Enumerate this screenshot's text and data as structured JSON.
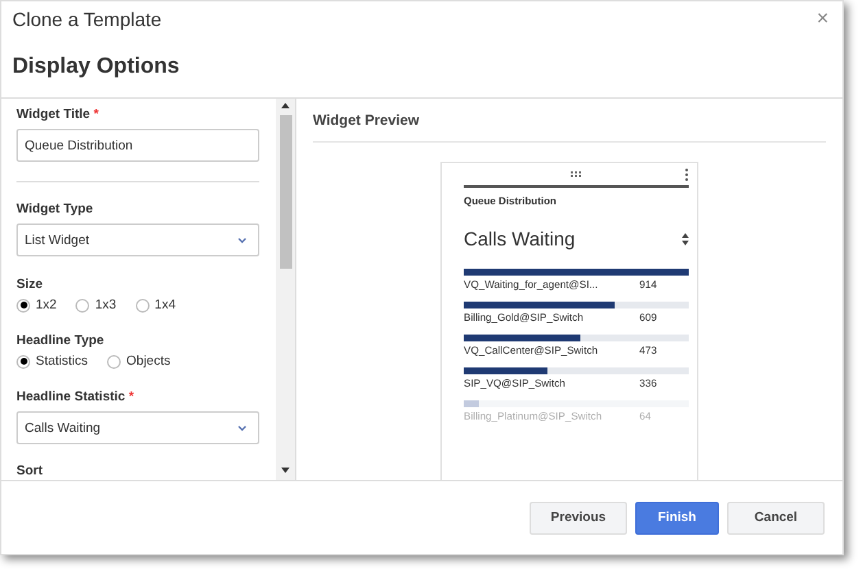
{
  "dialog": {
    "title": "Clone a Template",
    "close_icon": "×",
    "heading": "Display Options"
  },
  "form": {
    "widget_title": {
      "label": "Widget Title",
      "required_mark": "*",
      "value": "Queue Distribution"
    },
    "widget_type": {
      "label": "Widget Type",
      "value": "List Widget"
    },
    "size": {
      "label": "Size",
      "options": [
        {
          "label": "1x2",
          "selected": true
        },
        {
          "label": "1x3",
          "selected": false
        },
        {
          "label": "1x4",
          "selected": false
        }
      ]
    },
    "headline_type": {
      "label": "Headline Type",
      "options": [
        {
          "label": "Statistics",
          "selected": true
        },
        {
          "label": "Objects",
          "selected": false
        }
      ]
    },
    "headline_statistic": {
      "label": "Headline Statistic",
      "required_mark": "*",
      "value": "Calls Waiting"
    },
    "sort": {
      "label": "Sort"
    }
  },
  "preview": {
    "title": "Widget Preview",
    "widget": {
      "name": "Queue Distribution",
      "headline": "Calls Waiting",
      "rows": [
        {
          "name": "VQ_Waiting_for_agent@SI...",
          "value": "914",
          "level": 1.0,
          "faded": false
        },
        {
          "name": "Billing_Gold@SIP_Switch",
          "value": "609",
          "level": 0.67,
          "faded": false
        },
        {
          "name": "VQ_CallCenter@SIP_Switch",
          "value": "473",
          "level": 0.52,
          "faded": false
        },
        {
          "name": "SIP_VQ@SIP_Switch",
          "value": "336",
          "level": 0.37,
          "faded": false
        },
        {
          "name": "Billing_Platinum@SIP_Switch",
          "value": "64",
          "level": 0.07,
          "faded": true
        }
      ]
    }
  },
  "buttons": [
    {
      "label": "Previous",
      "primary": false
    },
    {
      "label": "Finish",
      "primary": true
    },
    {
      "label": "Cancel",
      "primary": false
    }
  ]
}
